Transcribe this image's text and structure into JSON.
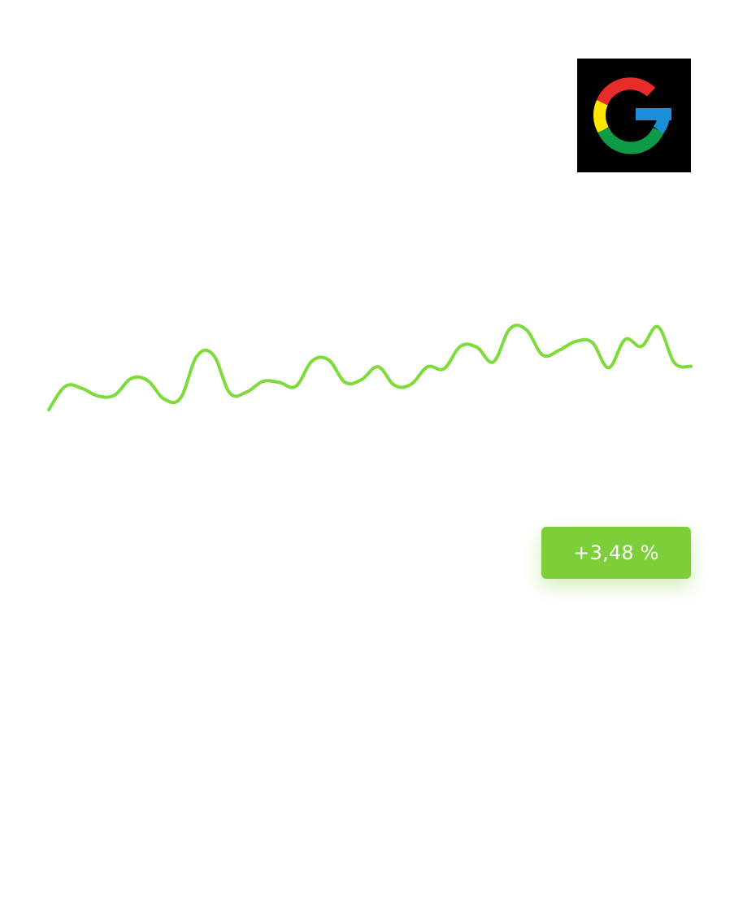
{
  "logo": {
    "icon": "google-g-icon",
    "background": "#000000",
    "colors": {
      "red": "#EA2B2B",
      "yellow": "#FFE600",
      "green": "#0E9B48",
      "blue": "#1A8FD8"
    }
  },
  "badge": {
    "label": "+3,48 %",
    "background": "#7DCF3A",
    "text_color": "#FFFFFF"
  },
  "chart_data": {
    "type": "line",
    "title": "",
    "xlabel": "",
    "ylabel": "",
    "grid": false,
    "legend": false,
    "line_color": "#7DDB3A",
    "ylim": [
      0,
      40
    ],
    "x": [
      0,
      1,
      2,
      3,
      4,
      5,
      6,
      7,
      8,
      9,
      10,
      11,
      12,
      13,
      14,
      15,
      16,
      17,
      18,
      19,
      20,
      21,
      22,
      23,
      24,
      25,
      26,
      27,
      28,
      29,
      30,
      31,
      32,
      33,
      34,
      35,
      36,
      37,
      38,
      39
    ],
    "series": [
      {
        "values": [
          6.0,
          10.8,
          10.4,
          8.8,
          9.0,
          12.4,
          12.0,
          8.2,
          8.4,
          17.0,
          17.2,
          9.4,
          9.6,
          11.8,
          11.6,
          10.8,
          16.0,
          16.2,
          11.6,
          12.2,
          14.8,
          11.0,
          11.2,
          14.8,
          14.4,
          19.0,
          18.8,
          15.8,
          22.6,
          22.4,
          17.2,
          18.2,
          20.0,
          19.8,
          14.6,
          20.4,
          19.0,
          23.0,
          15.6,
          14.9
        ]
      }
    ]
  }
}
